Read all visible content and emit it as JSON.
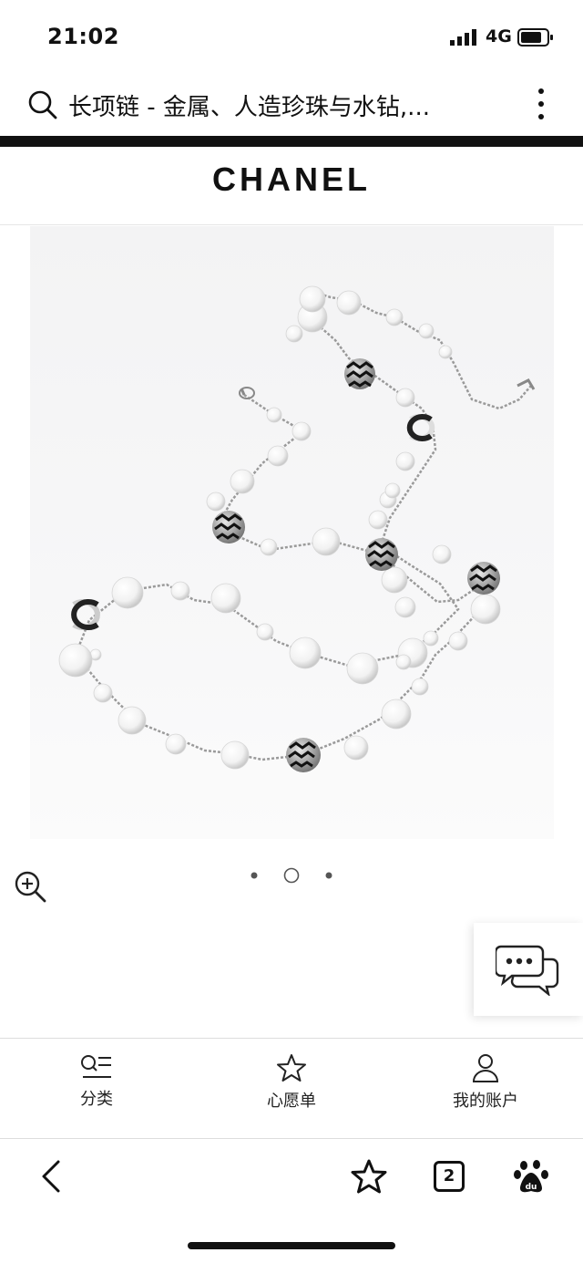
{
  "status_bar": {
    "time": "21:02",
    "network": "4G",
    "icons": [
      "signal-icon",
      "battery-icon"
    ]
  },
  "search": {
    "query": "长项链 - 金属、人造珍珠与水钻,...",
    "icons": [
      "search-icon",
      "more-vertical-icon"
    ]
  },
  "brand": {
    "name": "CHANEL"
  },
  "gallery": {
    "image_count": 3,
    "current_index": 2
  },
  "bottom_nav": {
    "items": [
      {
        "label": "分类",
        "icon": "category-list-icon"
      },
      {
        "label": "心愿单",
        "icon": "star-outline-icon"
      },
      {
        "label": "我的账户",
        "icon": "user-icon"
      }
    ]
  },
  "toolbar": {
    "tab_count": "2",
    "icons": [
      "back-icon",
      "star-icon",
      "tabs-icon",
      "baidu-icon"
    ]
  }
}
